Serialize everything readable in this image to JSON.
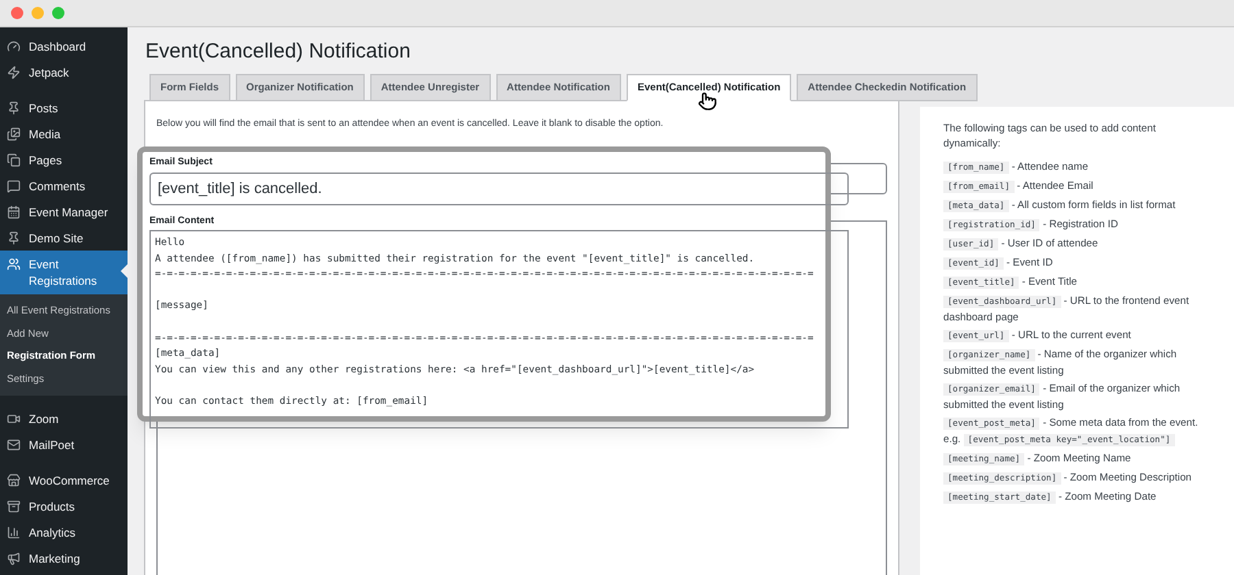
{
  "sidebar": {
    "items": [
      {
        "label": "Dashboard",
        "selected": false
      },
      {
        "label": "Jetpack",
        "selected": false
      },
      {
        "label": "Posts",
        "selected": false
      },
      {
        "label": "Media",
        "selected": false
      },
      {
        "label": "Pages",
        "selected": false
      },
      {
        "label": "Comments",
        "selected": false
      },
      {
        "label": "Event Manager",
        "selected": false
      },
      {
        "label": "Demo Site",
        "selected": false
      },
      {
        "label": "Event Registrations",
        "selected": true,
        "children": [
          {
            "label": "All Event Registrations",
            "selected": false
          },
          {
            "label": "Add New",
            "selected": false
          },
          {
            "label": "Registration Form",
            "selected": true
          },
          {
            "label": "Settings",
            "selected": false
          }
        ]
      },
      {
        "label": "Zoom",
        "selected": false
      },
      {
        "label": "MailPoet",
        "selected": false
      },
      {
        "label": "WooCommerce",
        "selected": false
      },
      {
        "label": "Products",
        "selected": false
      },
      {
        "label": "Analytics",
        "selected": false
      },
      {
        "label": "Marketing",
        "selected": false
      }
    ]
  },
  "page_title": "Event(Cancelled) Notification",
  "tabs": [
    {
      "label": "Form Fields",
      "selected": false
    },
    {
      "label": "Organizer Notification",
      "selected": false
    },
    {
      "label": "Attendee Unregister",
      "selected": false
    },
    {
      "label": "Attendee Notification",
      "selected": false
    },
    {
      "label": "Event(Cancelled) Notification",
      "selected": true
    },
    {
      "label": "Attendee Checkedin Notification",
      "selected": false
    }
  ],
  "intro": "Below you will find the email that is sent to an attendee when an event is cancelled. Leave it blank to disable the option.",
  "subject": {
    "label": "Email Subject",
    "value": "[event_title] is cancelled."
  },
  "content": {
    "label": "Email Content",
    "value": "Hello\nA attendee ([from_name]) has submitted their registration for the event \"[event_title]\" is cancelled.\n=-=-=-=-=-=-=-=-=-=-=-=-=-=-=-=-=-=-=-=-=-=-=-=-=-=-=-=-=-=-=-=-=-=-=-=-=-=-=-=-=-=-=-=-=-=-=-=-=-=-=-=-=-=-=-=\n\n[message]\n\n=-=-=-=-=-=-=-=-=-=-=-=-=-=-=-=-=-=-=-=-=-=-=-=-=-=-=-=-=-=-=-=-=-=-=-=-=-=-=-=-=-=-=-=-=-=-=-=-=-=-=-=-=-=-=-=\n[meta_data]\nYou can view this and any other registrations here: <a href=\"[event_dashboard_url]\">[event_title]</a>\n\nYou can contact them directly at: [from_email]"
  },
  "tags_panel": {
    "intro": "The following tags can be used to add content dynamically:",
    "tags": [
      {
        "code": "[from_name]",
        "text": "- Attendee name"
      },
      {
        "code": "[from_email]",
        "text": "- Attendee Email"
      },
      {
        "code": "[meta_data]",
        "text": "- All custom form fields in list format"
      },
      {
        "code": "[registration_id]",
        "text": "- Registration ID"
      },
      {
        "code": "[user_id]",
        "text": "- User ID of attendee"
      },
      {
        "code": "[event_id]",
        "text": "- Event ID"
      },
      {
        "code": "[event_title]",
        "text": "- Event Title"
      },
      {
        "code": "[event_dashboard_url]",
        "text": "- URL to the frontend event dashboard page"
      },
      {
        "code": "[event_url]",
        "text": "- URL to the current event"
      },
      {
        "code": "[organizer_name]",
        "text": "- Name of the organizer which submitted the event listing"
      },
      {
        "code": "[organizer_email]",
        "text": "- Email of the organizer which submitted the event listing"
      },
      {
        "code": "[event_post_meta]",
        "text": "- Some meta data from the event. e.g.",
        "code2": "[event_post_meta key=\"_event_location\"]"
      },
      {
        "code": "[meeting_name]",
        "text": "- Zoom Meeting Name"
      },
      {
        "code": "[meeting_description]",
        "text": "- Zoom Meeting Description"
      },
      {
        "code": "[meeting_start_date]",
        "text": "- Zoom Meeting Date"
      }
    ]
  }
}
